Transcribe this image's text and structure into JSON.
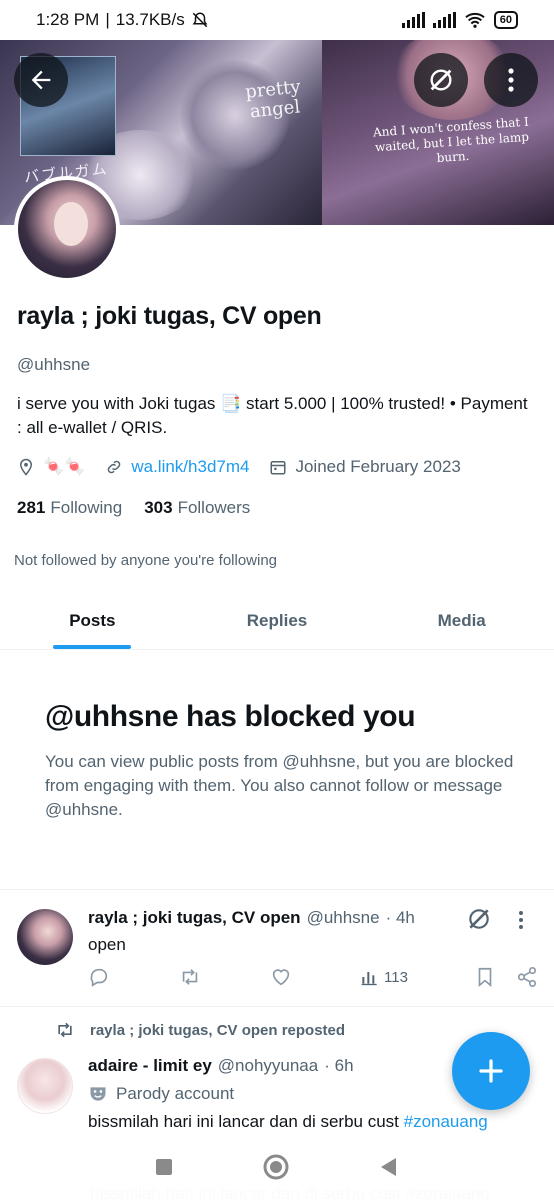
{
  "status_bar": {
    "time": "1:28 PM",
    "speed": "13.7KB/s",
    "battery": "60"
  },
  "banner": {
    "jp_text": "バブルガム",
    "pretty_text": "pretty angel",
    "quote": "And I won't confess that I waited, but I let the lamp burn."
  },
  "profile": {
    "name": "rayla ; joki tugas, CV open",
    "handle": "@uhhsne",
    "bio": "i serve you with Joki tugas 📑 start 5.000 | 100% trusted! • Payment : all e-wallet / QRIS.",
    "location": "🍬🍬",
    "link": "wa.link/h3d7m4",
    "joined": "Joined February 2023",
    "following_count": "281",
    "following_label": "Following",
    "followers_count": "303",
    "followers_label": "Followers",
    "not_followed": "Not followed by anyone you're following"
  },
  "tabs": [
    {
      "label": "Posts"
    },
    {
      "label": "Replies"
    },
    {
      "label": "Media"
    }
  ],
  "blocked": {
    "title": "@uhhsne has blocked you",
    "description": "You can view public posts from @uhhsne, but you are blocked from engaging with them. You also cannot follow or message @uhhsne."
  },
  "post1": {
    "name": "rayla ; joki tugas, CV open",
    "handle": "@uhhsne",
    "time": "· 4h",
    "text": "open",
    "views": "113"
  },
  "repost": {
    "label": "rayla ; joki tugas, CV open reposted",
    "name": "adaire - limit ey",
    "handle": "@nohyyunaa",
    "time": "· 6h",
    "parody": "Parody account",
    "text": "bissmilah hari ini lancar dan di serbu cust ",
    "hashtag": "#zonauang"
  },
  "colors": {
    "accent": "#1d9bf0",
    "text": "#0f1419",
    "secondary": "#536471"
  },
  "icons": [
    "back-arrow-icon",
    "grok-icon",
    "more-icon",
    "location-icon",
    "link-icon",
    "calendar-icon",
    "reply-icon",
    "retweet-icon",
    "like-icon",
    "views-icon",
    "bookmark-icon",
    "share-icon",
    "plus-icon"
  ]
}
